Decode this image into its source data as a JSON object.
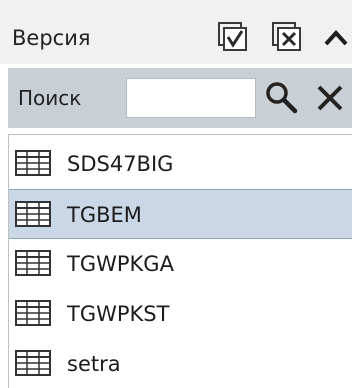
{
  "header": {
    "title": "Версия",
    "check_all_icon": "checkbox-checked-icon",
    "uncheck_all_icon": "checkbox-x-icon",
    "collapse_icon": "chevron-up-icon"
  },
  "search": {
    "label": "Поиск",
    "value": "",
    "placeholder": "",
    "search_icon": "search-icon",
    "clear_icon": "close-icon"
  },
  "list": {
    "items": [
      {
        "label": "SDS47BIG",
        "icon": "table-icon",
        "selected": false
      },
      {
        "label": "TGBEM",
        "icon": "table-icon",
        "selected": true
      },
      {
        "label": "TGWPKGA",
        "icon": "table-icon",
        "selected": false
      },
      {
        "label": "TGWPKST",
        "icon": "table-icon",
        "selected": false
      },
      {
        "label": "setra",
        "icon": "table-icon",
        "selected": false
      }
    ]
  },
  "colors": {
    "header_bg": "#f1f1f1",
    "searchbar_bg": "#c9d0d5",
    "selected_bg": "#c9d7e6",
    "selected_border": "#8fa6bd",
    "icon_dark": "#2a2a2a"
  }
}
